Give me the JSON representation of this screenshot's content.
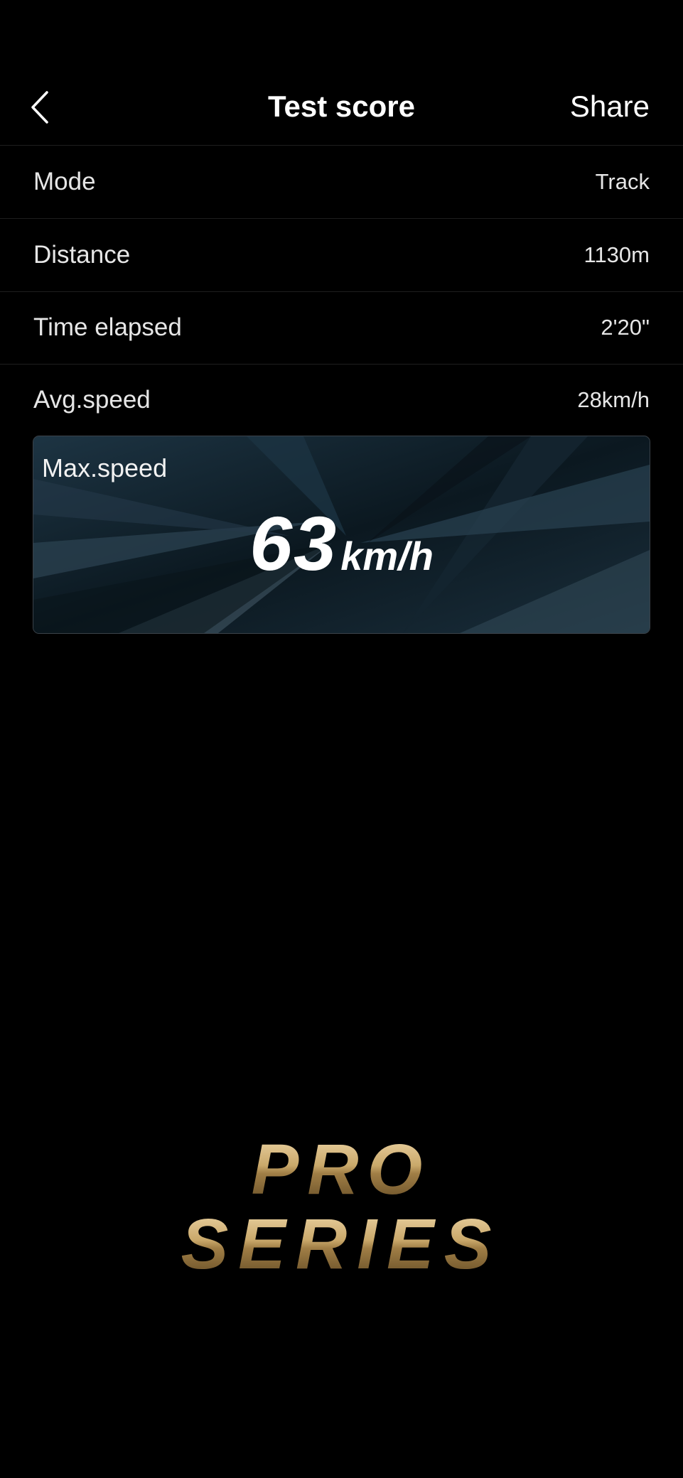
{
  "header": {
    "back_icon": "chevron-left-icon",
    "title": "Test score",
    "share_label": "Share"
  },
  "stats": [
    {
      "label": "Mode",
      "value": "Track"
    },
    {
      "label": "Distance",
      "value": "1130m"
    },
    {
      "label": "Time elapsed",
      "value": "2'20\""
    },
    {
      "label": "Avg.speed",
      "value": "28km/h"
    }
  ],
  "max_speed": {
    "label": "Max.speed",
    "value": "63",
    "unit": "km/h"
  },
  "logo": {
    "line1": "PRO",
    "line2": "SERIES",
    "color": "#c9a86a"
  },
  "colors": {
    "background": "#000000",
    "text": "#ffffff",
    "divider": "#1e1e1e",
    "card": "#0d1a23"
  }
}
